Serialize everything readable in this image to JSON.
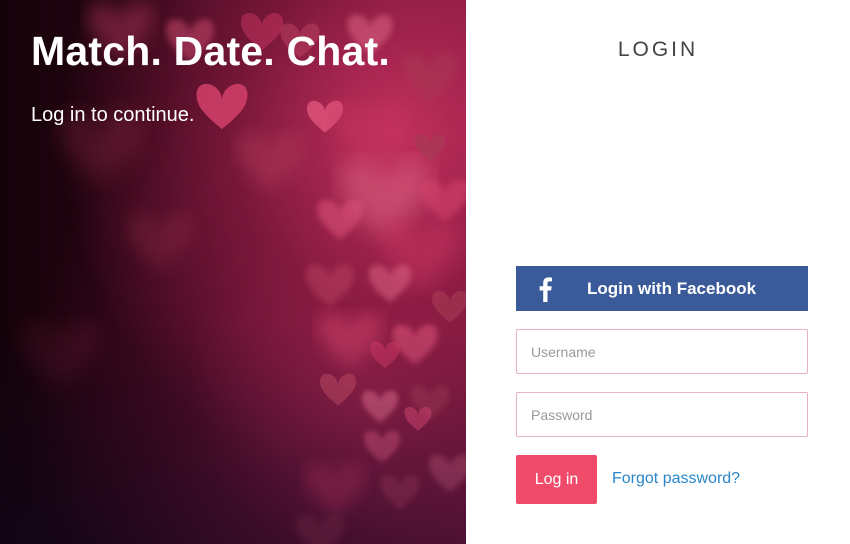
{
  "hero": {
    "title": "Match. Date. Chat.",
    "subtitle": "Log in to continue."
  },
  "login": {
    "heading": "LOGIN",
    "facebook_button": "Login with Facebook",
    "facebook_icon": "facebook-f-icon",
    "username_placeholder": "Username",
    "password_placeholder": "Password",
    "submit_label": "Log in",
    "forgot_label": "Forgot password?"
  },
  "colors": {
    "facebook_blue": "#3b5a9a",
    "login_button": "#f04b6b",
    "link_blue": "#2a86c9",
    "field_border": "#e7b3c2",
    "hero_dark": "#2a0514",
    "heart_pink": "#d8446e"
  }
}
